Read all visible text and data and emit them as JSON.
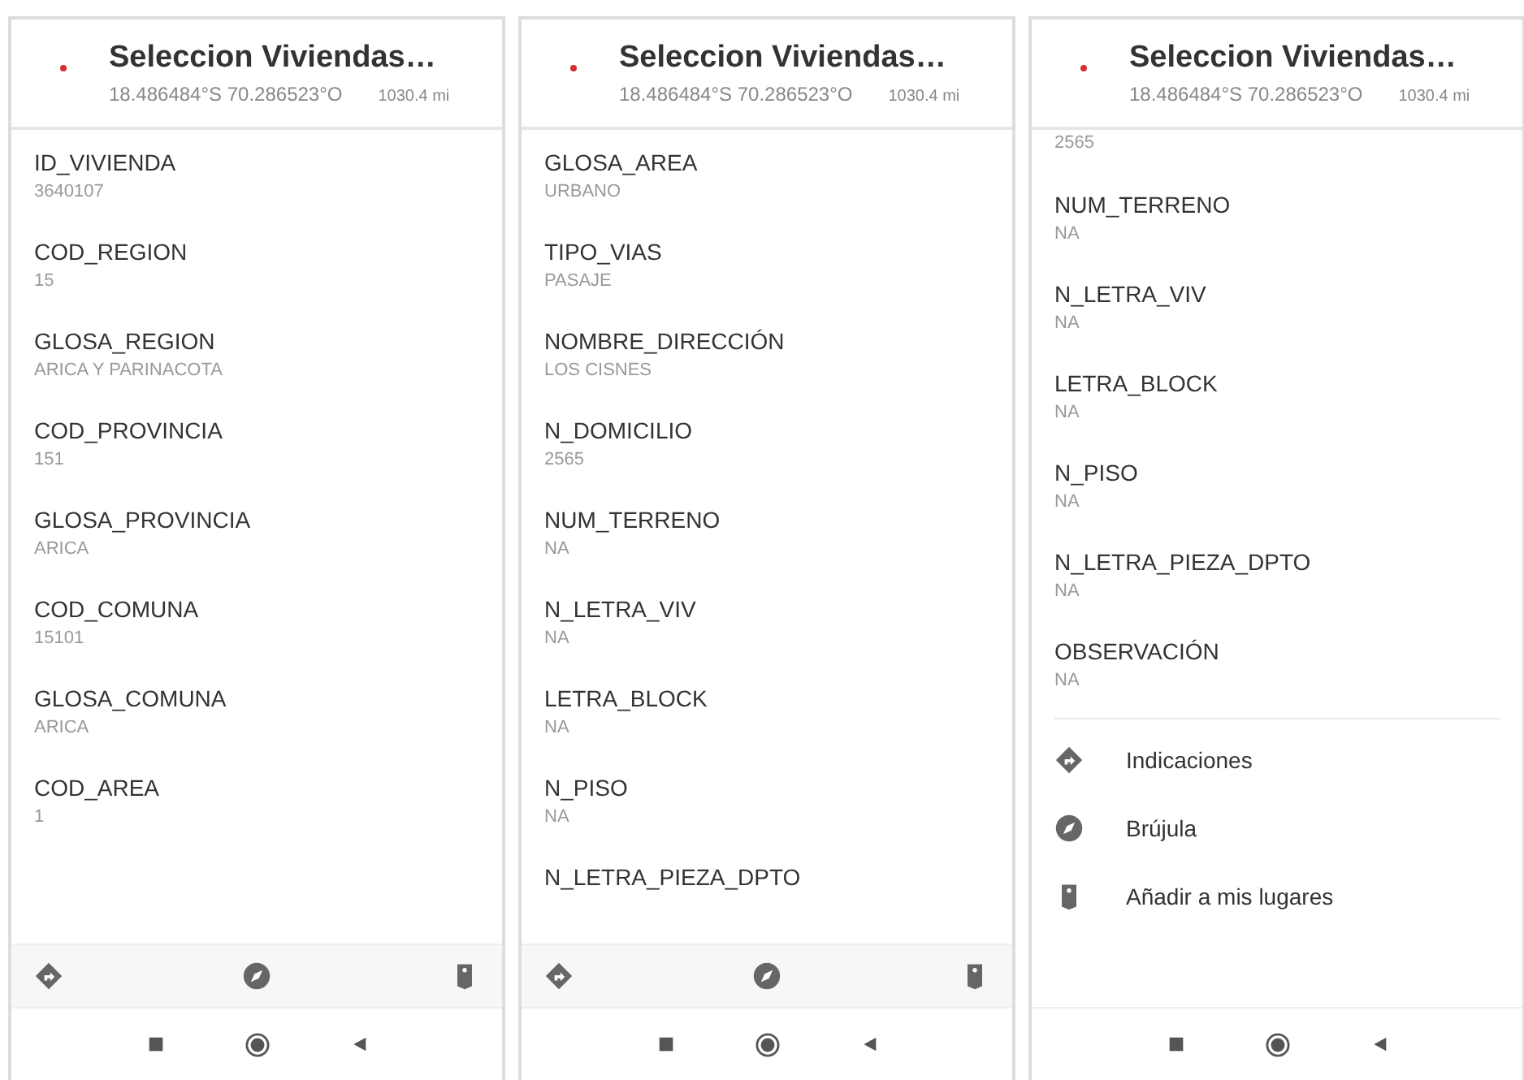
{
  "panels": [
    {
      "title": "Seleccion Viviendas…",
      "coords": "18.486484°S  70.286523°O",
      "distance": "1030.4 mi",
      "fields": [
        {
          "label": "ID_VIVIENDA",
          "value": "3640107"
        },
        {
          "label": "COD_REGION",
          "value": "15"
        },
        {
          "label": "GLOSA_REGION",
          "value": "ARICA Y PARINACOTA"
        },
        {
          "label": "COD_PROVINCIA",
          "value": "151"
        },
        {
          "label": "GLOSA_PROVINCIA",
          "value": "ARICA"
        },
        {
          "label": "COD_COMUNA",
          "value": "15101"
        },
        {
          "label": "GLOSA_COMUNA",
          "value": "ARICA"
        },
        {
          "label": "COD_AREA",
          "value": "1"
        }
      ],
      "kind": "bar",
      "actions": [
        {
          "kind": "directions"
        },
        {
          "kind": "compass"
        },
        {
          "kind": "bookmark"
        }
      ]
    },
    {
      "title": "Seleccion Viviendas…",
      "coords": "18.486484°S  70.286523°O",
      "distance": "1030.4 mi",
      "fields": [
        {
          "label": "GLOSA_AREA",
          "value": "URBANO"
        },
        {
          "label": "TIPO_VIAS",
          "value": "PASAJE"
        },
        {
          "label": "NOMBRE_DIRECCIÓN",
          "value": "LOS CISNES"
        },
        {
          "label": "N_DOMICILIO",
          "value": "2565"
        },
        {
          "label": "NUM_TERRENO",
          "value": "NA"
        },
        {
          "label": "N_LETRA_VIV",
          "value": "NA"
        },
        {
          "label": "LETRA_BLOCK",
          "value": "NA"
        },
        {
          "label": "N_PISO",
          "value": "NA"
        },
        {
          "label": "N_LETRA_PIEZA_DPTO"
        }
      ],
      "kind": "bar",
      "actions": [
        {
          "kind": "directions"
        },
        {
          "kind": "compass"
        },
        {
          "kind": "bookmark"
        }
      ]
    },
    {
      "title": "Seleccion Viviendas…",
      "coords": "18.486484°S  70.286523°O",
      "distance": "1030.4 mi",
      "fields": [
        {
          "value": "2565"
        },
        {
          "label": "NUM_TERRENO",
          "value": "NA"
        },
        {
          "label": "N_LETRA_VIV",
          "value": "NA"
        },
        {
          "label": "LETRA_BLOCK",
          "value": "NA"
        },
        {
          "label": "N_PISO",
          "value": "NA"
        },
        {
          "label": "N_LETRA_PIEZA_DPTO",
          "value": "NA"
        },
        {
          "label": "OBSERVACIÓN",
          "value": "NA"
        }
      ],
      "kind": "list",
      "actions": [
        {
          "kind": "directions",
          "label": "Indicaciones"
        },
        {
          "kind": "compass",
          "label": "Brújula"
        },
        {
          "kind": "bookmark",
          "label": "Añadir a mis lugares"
        }
      ]
    }
  ]
}
